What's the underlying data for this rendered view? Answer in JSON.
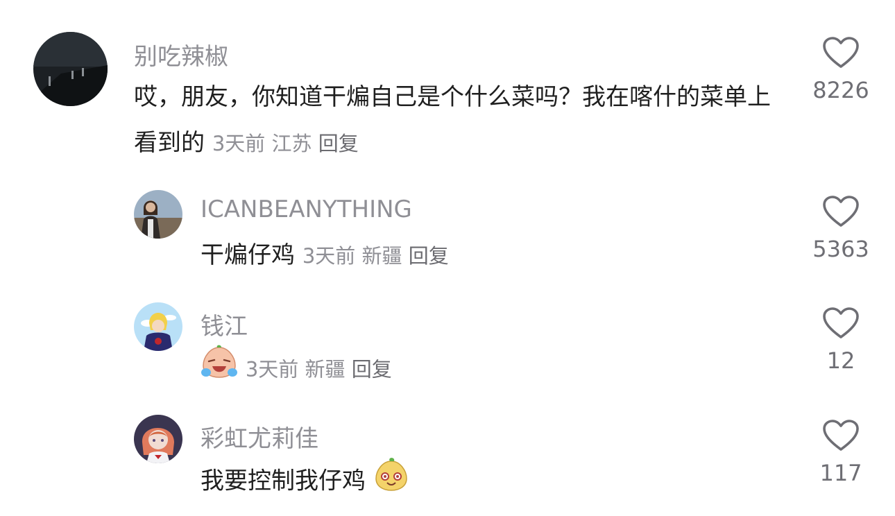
{
  "comments": [
    {
      "username": "别吃辣椒",
      "text": "哎，朋友，你知道干煸自己是个什么菜吗？我在喀什的菜单上看到的",
      "time": "3天前",
      "location": "江苏",
      "reply_label": "回复",
      "likes": "8226",
      "avatar_icon": "dark-night-photo-avatar"
    },
    {
      "username": "ICANBEANYTHING",
      "text": "干煸仔鸡",
      "time": "3天前",
      "location": "新疆",
      "reply_label": "回复",
      "likes": "5363",
      "avatar_icon": "woman-photo-avatar"
    },
    {
      "username": "钱江",
      "emoji": "crying-laugh-emoji",
      "time": "3天前",
      "location": "新疆",
      "reply_label": "回复",
      "likes": "12",
      "avatar_icon": "anime-character-avatar"
    },
    {
      "username": "彩虹尤莉佳",
      "text": "我要控制我仔鸡",
      "emoji": "smug-face-emoji",
      "likes": "117",
      "avatar_icon": "anime-girl-avatar"
    }
  ],
  "colors": {
    "username": "#8f8f95",
    "text": "#1f1f1f",
    "meta": "#8f8f95"
  }
}
